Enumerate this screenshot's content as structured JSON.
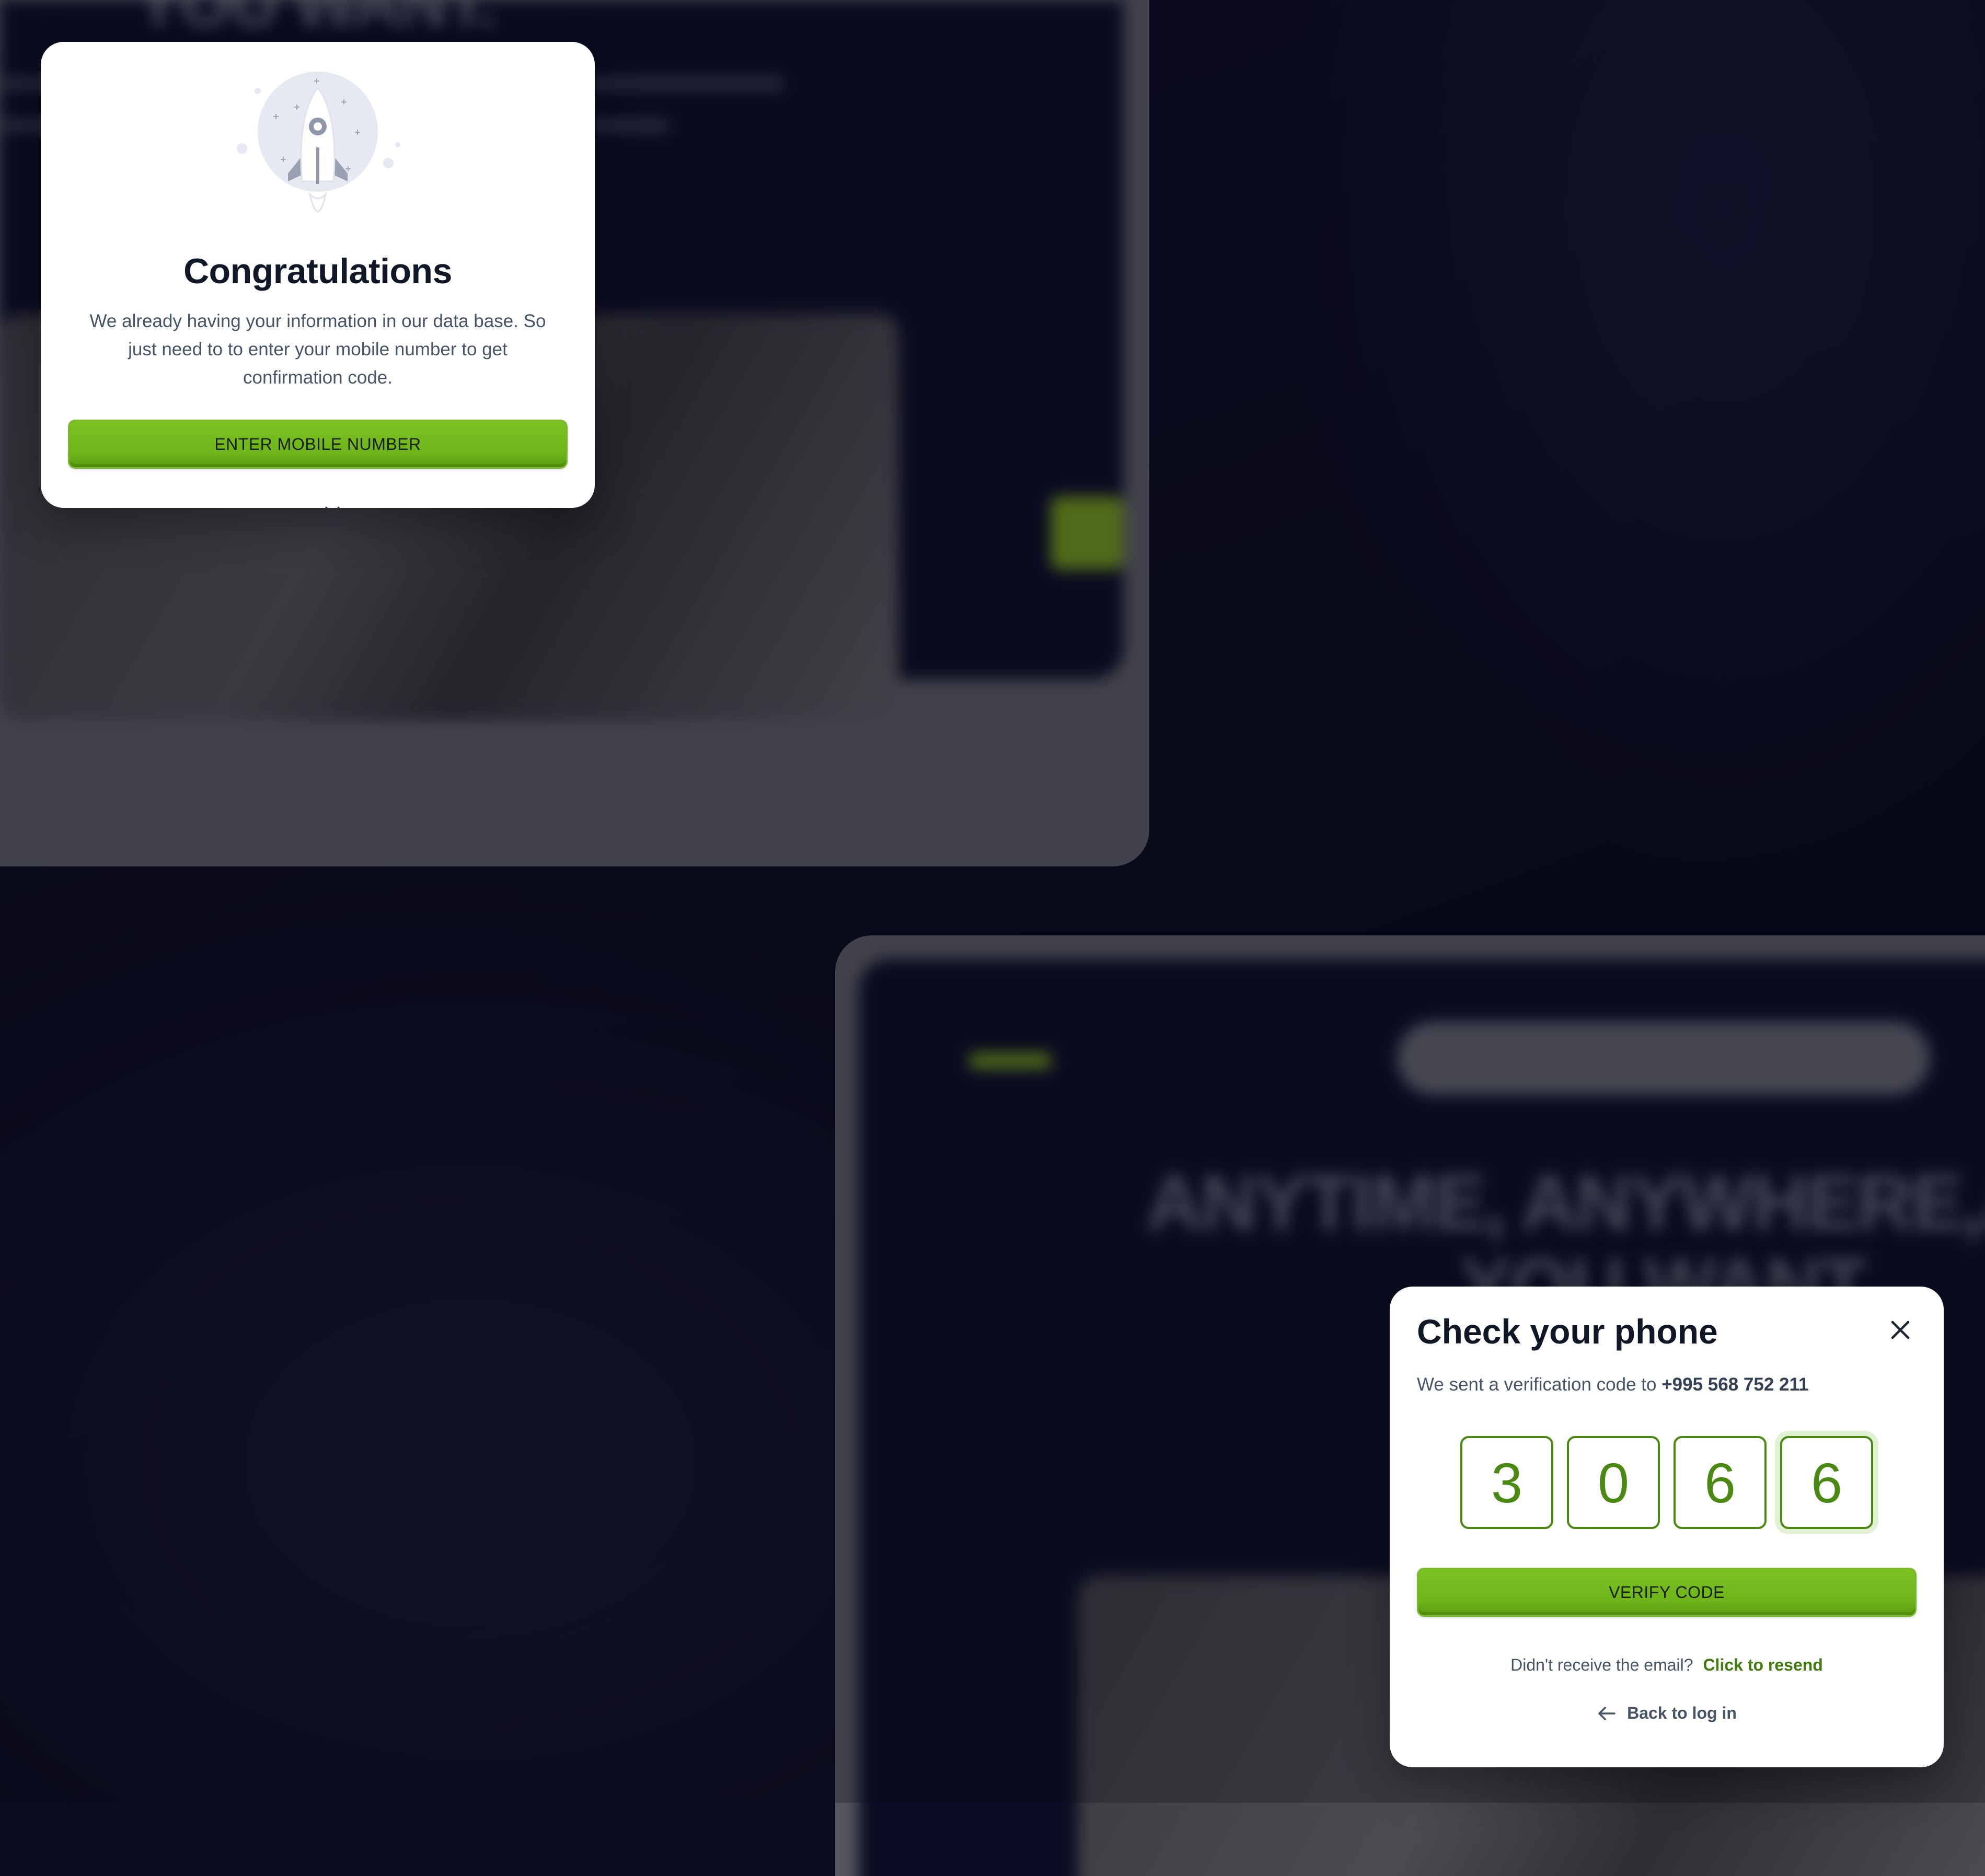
{
  "background": {
    "headline_top": "YOU WANT.",
    "headline_bottom_1": "ANYTIME, ANYWHERE,AN",
    "headline_bottom_2": "YOU WANT."
  },
  "congrats_modal": {
    "icon": "rocket-icon",
    "title": "Congratulations",
    "body": "We already having your information in our data base. So just need to to enter your mobile number to get confirmation code.",
    "button_label": "ENTER MOBILE NUMBER"
  },
  "verify_modal": {
    "title": "Check your phone",
    "subtitle_prefix": "We sent a verification code to",
    "phone": "+995 568 752 211",
    "code_digits": [
      "3",
      "0",
      "6",
      "6"
    ],
    "button_label": "VERIFY CODE",
    "resend_prompt": "Didn't receive the email?",
    "resend_link": "Click to resend",
    "back_label": "Back to log in"
  },
  "colors": {
    "accent_green": "#6db51a",
    "code_green": "#4a8a12",
    "page_bg": "#0b0c1e"
  }
}
